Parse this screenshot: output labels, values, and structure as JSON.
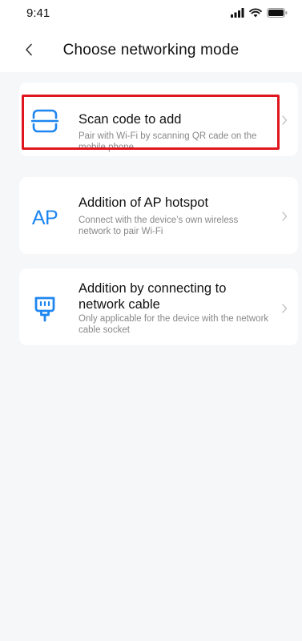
{
  "status_bar": {
    "time": "9:41"
  },
  "nav": {
    "title": "Choose networking mode"
  },
  "options": [
    {
      "icon": "scan-code-icon",
      "title": "Scan code to add",
      "description": "Pair with Wi-Fi by scanning QR cade on the mobile phone"
    },
    {
      "icon": "ap-hotspot-icon",
      "icon_text": "AP",
      "title": "Addition of AP hotspot",
      "description": "Connect with the device’s own wireless network to pair Wi-Fi"
    },
    {
      "icon": "network-cable-icon",
      "title": "Addition by connecting to network cable",
      "description": "Only applicable for the device with the network cable socket"
    }
  ],
  "colors": {
    "accent": "#1e86f0",
    "highlight": "#e0161f",
    "background": "#f6f7f9"
  }
}
